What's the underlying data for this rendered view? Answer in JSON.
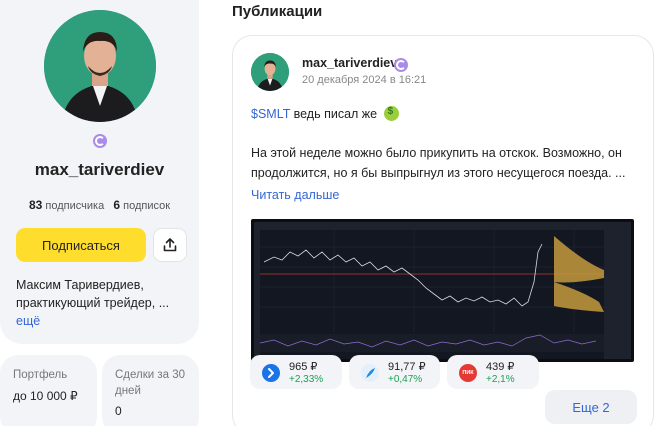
{
  "profile": {
    "username": "max_tariverdiev",
    "followers_count": "83",
    "followers_label": "подписчика",
    "following_count": "6",
    "following_label": "подписок",
    "subscribe_label": "Подписаться",
    "bio": "Максим Таривердиев, практикующий трейдер, ...",
    "more_label": "ещё"
  },
  "stats": [
    {
      "label": "Портфель",
      "value": "до 10 000 ₽"
    },
    {
      "label": "Сделки за 30 дней",
      "value": "0"
    }
  ],
  "feed": {
    "title": "Публикации",
    "post": {
      "author": "max_tariverdiev",
      "date": "20 декабря 2024 в 16:21",
      "ticker": "$SMLT",
      "ticker_text": "ведь писал же",
      "body": "На этой неделе можно было прикупить на отскок. Возможно, он продолжится, но я бы выпрыгнул из этого несущегося поезда. ...",
      "read_more": "Читать дальше"
    },
    "quotes": [
      {
        "price": "965 ₽",
        "change": "+2,33%",
        "icon": "arrow-logo-icon",
        "color": "#1a73e8"
      },
      {
        "price": "91,77 ₽",
        "change": "+0,47%",
        "icon": "feather-logo-icon",
        "color": "#1e88e5"
      },
      {
        "price": "439 ₽",
        "change": "+2,1%",
        "icon": "pik-logo-icon",
        "color": "#e53935",
        "icon_text": "ПИК"
      }
    ],
    "more_quotes_label": "Еще 2"
  },
  "colors": {
    "accent_yellow": "#ffdd2d",
    "link_blue": "#3367d6",
    "positive_green": "#1aa156",
    "avatar_green": "#2f9e7a"
  }
}
